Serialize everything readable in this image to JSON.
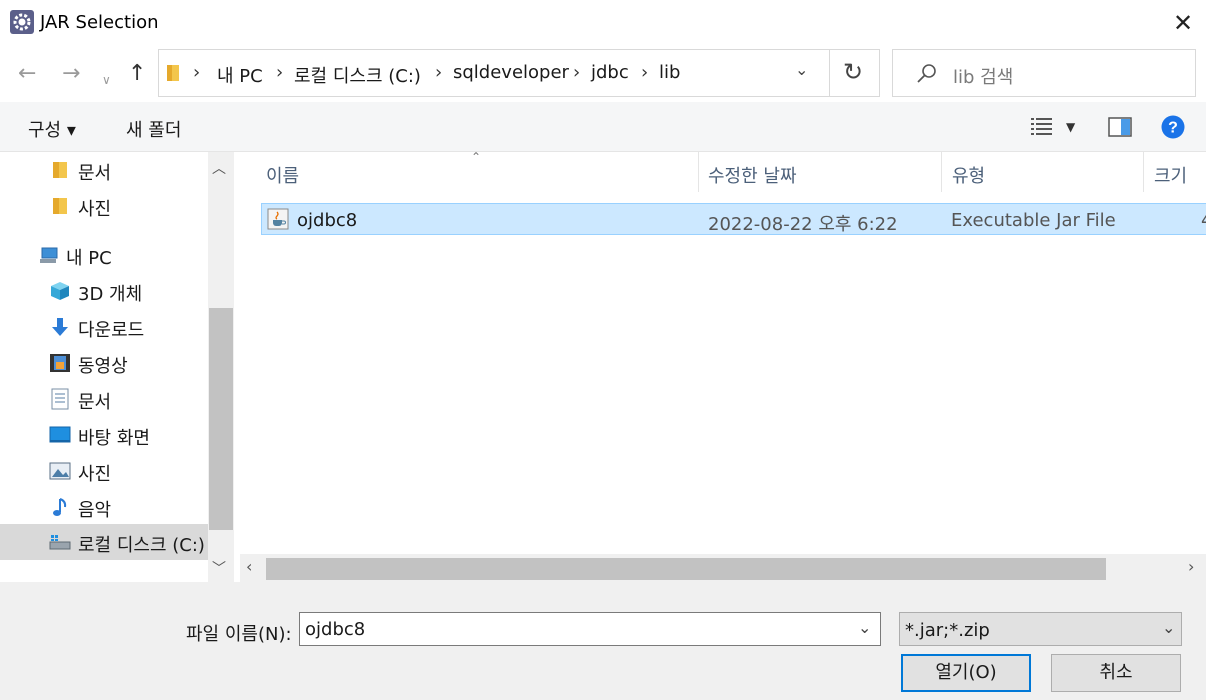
{
  "window": {
    "title": "JAR Selection"
  },
  "nav": {
    "path": [
      "내 PC",
      "로컬 디스크 (C:)",
      "sqldeveloper",
      "jdbc",
      "lib"
    ],
    "search_placeholder": "lib 검색"
  },
  "toolbar": {
    "organize": "구성 ▾",
    "new_folder": "새 폴더"
  },
  "sidebar": {
    "items": [
      {
        "label": "문서",
        "icon": "folder-icon"
      },
      {
        "label": "사진",
        "icon": "folder-icon"
      },
      {
        "label": "내 PC",
        "icon": "computer-icon"
      },
      {
        "label": "3D 개체",
        "icon": "cube-icon"
      },
      {
        "label": "다운로드",
        "icon": "download-icon"
      },
      {
        "label": "동영상",
        "icon": "video-icon"
      },
      {
        "label": "문서",
        "icon": "document-icon"
      },
      {
        "label": "바탕 화면",
        "icon": "desktop-icon"
      },
      {
        "label": "사진",
        "icon": "picture-icon"
      },
      {
        "label": "음악",
        "icon": "music-icon"
      },
      {
        "label": "로컬 디스크 (C:)",
        "icon": "drive-icon",
        "selected": true
      }
    ]
  },
  "columns": {
    "name": "이름",
    "modified": "수정한 날짜",
    "type": "유형",
    "size": "크기"
  },
  "files": [
    {
      "name": "ojdbc8",
      "modified": "2022-08-22 오후 6:22",
      "type": "Executable Jar File",
      "size": "4"
    }
  ],
  "footer": {
    "filename_label": "파일 이름(N):",
    "filename_value": "ojdbc8",
    "filetype_value": "*.jar;*.zip",
    "open_label": "열기(O)",
    "cancel_label": "취소"
  },
  "colors": {
    "selection": "#cce8ff",
    "accent": "#0078d7",
    "help": "#1a73e8"
  }
}
